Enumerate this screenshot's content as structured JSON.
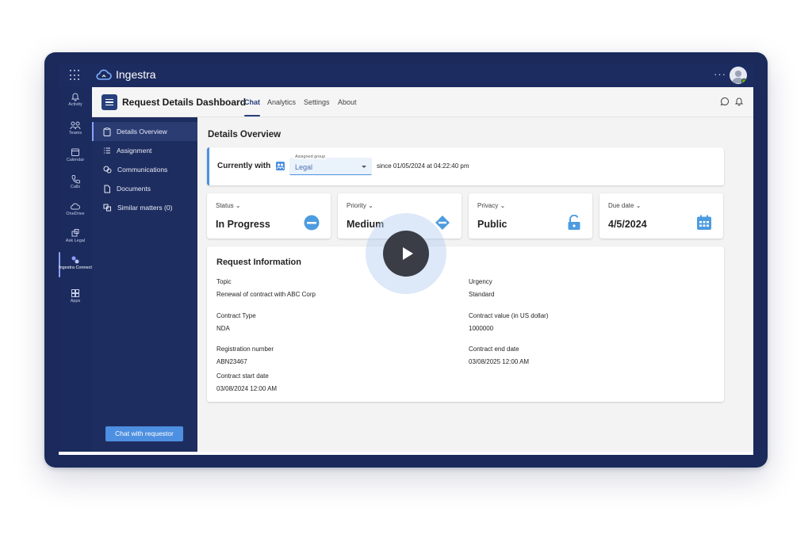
{
  "app": {
    "name": "Ingestra",
    "more": "···"
  },
  "rail": [
    {
      "label": "Activity",
      "icon": "bell-icon"
    },
    {
      "label": "Teams",
      "icon": "teams-icon"
    },
    {
      "label": "Calendar",
      "icon": "calendar-icon"
    },
    {
      "label": "Calls",
      "icon": "phone-icon"
    },
    {
      "label": "OneDrive",
      "icon": "cloud-icon"
    },
    {
      "label": "Ask Legal",
      "icon": "ask-legal-icon"
    },
    {
      "label": "Ingestra Connect",
      "icon": "ingestra-connect-icon",
      "active": true
    },
    {
      "label": "Apps",
      "icon": "apps-icon"
    }
  ],
  "header": {
    "title": "Request Details Dashboard",
    "tabs": [
      "Chat",
      "Analytics",
      "Settings",
      "About"
    ],
    "active_tab": "Chat"
  },
  "sidebar": {
    "items": [
      {
        "label": "Details Overview",
        "icon": "clipboard-icon",
        "active": true
      },
      {
        "label": "Assignment",
        "icon": "list-icon"
      },
      {
        "label": "Communications",
        "icon": "chat-bubbles-icon"
      },
      {
        "label": "Documents",
        "icon": "document-icon"
      },
      {
        "label": "Similar matters (0)",
        "icon": "similar-icon"
      }
    ],
    "chat_button": "Chat with requestor"
  },
  "main": {
    "title": "Details Overview",
    "currently_with": {
      "label": "Currently with",
      "field_caption": "Assigned group",
      "value": "Legal",
      "since": "since 01/05/2024 at 04:22:40 pm"
    },
    "stats": [
      {
        "label": "Status",
        "value": "In Progress",
        "icon": "in-progress-icon"
      },
      {
        "label": "Priority",
        "value": "Medium",
        "icon": "priority-diamond-icon"
      },
      {
        "label": "Privacy",
        "value": "Public",
        "icon": "unlock-icon"
      },
      {
        "label": "Due date",
        "value": "4/5/2024",
        "icon": "calendar-icon"
      }
    ],
    "request": {
      "title": "Request Information",
      "topic_label": "Topic",
      "topic": "Renewal of contract with ABC Corp",
      "urgency_label": "Urgency",
      "urgency": "Standard",
      "contract_type_label": "Contract Type",
      "contract_type": "NDA",
      "contract_value_label": "Contract value (in US dollar)",
      "contract_value": "1000000",
      "registration_label": "Registration number",
      "registration": "ABN23467",
      "end_date_label": "Contract end date",
      "end_date": "03/08/2025 12:00 AM",
      "start_date_label": "Contract start date",
      "start_date": "03/08/2024 12:00 AM"
    }
  },
  "colors": {
    "accent": "#4d8fe0",
    "brand_dark": "#1b2b5e",
    "sidebar_active": "#2b3c73",
    "presence": "#6bb700"
  }
}
